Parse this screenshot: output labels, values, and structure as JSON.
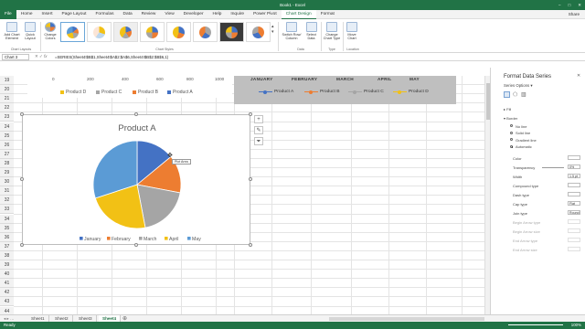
{
  "window": {
    "title": "Book1 - Excel",
    "controls": [
      "–",
      "□",
      "✕"
    ],
    "share": "Share"
  },
  "ribbon_tabs": [
    "File",
    "Home",
    "Insert",
    "Page Layout",
    "Formulas",
    "Data",
    "Review",
    "View",
    "Developer",
    "Help",
    "Inquire",
    "Power Pivot",
    "Chart Design",
    "Format"
  ],
  "ribbon_active": "Chart Design",
  "ribbon": {
    "add_chart_element": "Add Chart Element",
    "quick_layout": "Quick Layout",
    "change_colors": "Change Colors",
    "group_layouts": "Chart Layouts",
    "group_styles": "Chart Styles",
    "switch_row_col": "Switch Row/ Column",
    "select_data": "Select Data",
    "group_data": "Data",
    "change_chart_type": "Change Chart Type",
    "group_type": "Type",
    "move_chart": "Move Chart",
    "group_location": "Location"
  },
  "formula_bar": {
    "name_box": "Chart 3",
    "formula": "=SERIES(Sheet4!$B$1,Sheet4!$A$2:$A$6,Sheet4!$B$2:$B$6,1)"
  },
  "columns": [
    "A",
    "B",
    "C",
    "D",
    "E",
    "F",
    "G",
    "H",
    "I",
    "J",
    "K",
    "L",
    "M",
    "N"
  ],
  "rows": [
    "19",
    "20",
    "21",
    "22",
    "23",
    "24",
    "25",
    "26",
    "27",
    "28",
    "29",
    "30",
    "31",
    "32",
    "33",
    "34",
    "35",
    "36",
    "37",
    "38",
    "39",
    "40",
    "41",
    "42",
    "43",
    "44"
  ],
  "chart1": {
    "axis_ticks": [
      "0",
      "200",
      "400",
      "600",
      "800",
      "1000"
    ],
    "legend": [
      {
        "label": "Product D",
        "color": "#f2c115"
      },
      {
        "label": "Product C",
        "color": "#a5a5a5"
      },
      {
        "label": "Product B",
        "color": "#ed7d31"
      },
      {
        "label": "Product A",
        "color": "#4472c4"
      }
    ]
  },
  "chart2": {
    "months": [
      "JANUARY",
      "FEBRUARY",
      "MARCH",
      "APRIL",
      "MAY"
    ],
    "legend": [
      {
        "label": "Product A",
        "color": "#4472c4"
      },
      {
        "label": "Product B",
        "color": "#ed7d31"
      },
      {
        "label": "Product C",
        "color": "#a5a5a5"
      },
      {
        "label": "Product D",
        "color": "#f2c115"
      }
    ]
  },
  "chart_data": {
    "type": "pie",
    "title": "Product A",
    "categories": [
      "January",
      "February",
      "March",
      "April",
      "May"
    ],
    "values": [
      14,
      14,
      19,
      23,
      30
    ],
    "colors": [
      "#4472c4",
      "#ed7d31",
      "#a5a5a5",
      "#f2c115",
      "#5b9bd5"
    ],
    "legend_position": "bottom"
  },
  "tooltip": "Plot Area",
  "panel": {
    "title": "Format Data Series",
    "subtitle": "Series Options",
    "fill": "Fill",
    "border": "Border",
    "border_options": [
      "No line",
      "Solid line",
      "Gradient line",
      "Automatic"
    ],
    "border_selected": "Automatic",
    "props": [
      {
        "label": "Color",
        "value": ""
      },
      {
        "label": "Transparency",
        "value": "0%"
      },
      {
        "label": "Width",
        "value": "1.5 pt"
      },
      {
        "label": "Compound type",
        "value": ""
      },
      {
        "label": "Dash type",
        "value": ""
      },
      {
        "label": "Cap type",
        "value": "Flat"
      },
      {
        "label": "Join type",
        "value": "Round"
      },
      {
        "label": "Begin Arrow type",
        "value": ""
      },
      {
        "label": "Begin Arrow size",
        "value": ""
      },
      {
        "label": "End Arrow type",
        "value": ""
      },
      {
        "label": "End Arrow size",
        "value": ""
      }
    ]
  },
  "sheets": [
    "Sheet1",
    "Sheet2",
    "Sheet3",
    "Sheet4"
  ],
  "active_sheet": "Sheet4",
  "status": {
    "left": "Ready",
    "zoom": "100%"
  }
}
